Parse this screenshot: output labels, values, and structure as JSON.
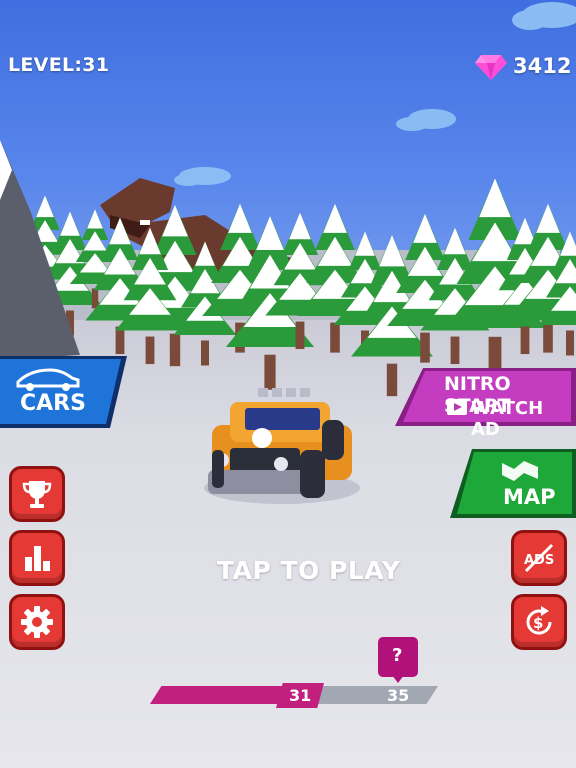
{
  "hud": {
    "level": "LEVEL:31",
    "gems": "3412"
  },
  "buttons": {
    "cars": "CARS",
    "nitro_line1": "NITRO START",
    "nitro_line2": "WATCH AD",
    "map": "MAP",
    "tap_to_play": "TAP TO PLAY"
  },
  "progress": {
    "current": "31",
    "next": "35",
    "fill_fraction": 0.5,
    "reward": "?"
  },
  "icons": {
    "gem": "diamond-icon",
    "cars": "sports-car-icon",
    "nitro": "video-ad-icon",
    "map": "road-map-icon",
    "trophy": "trophy-icon",
    "leaderboard": "bar-chart-icon",
    "settings": "gear-icon",
    "no_ads": "no-ads-icon",
    "restore": "restore-purchase-icon"
  },
  "colors": {
    "sky": "#4f7fe8",
    "gem": "#ff4fd8",
    "cars_button": "#1f74d9",
    "nitro_button": "#c43dc1",
    "map_button": "#1fa83a",
    "red_button": "#e53935",
    "progress_fill": "#c2207f",
    "car_body": "#f2a531"
  }
}
